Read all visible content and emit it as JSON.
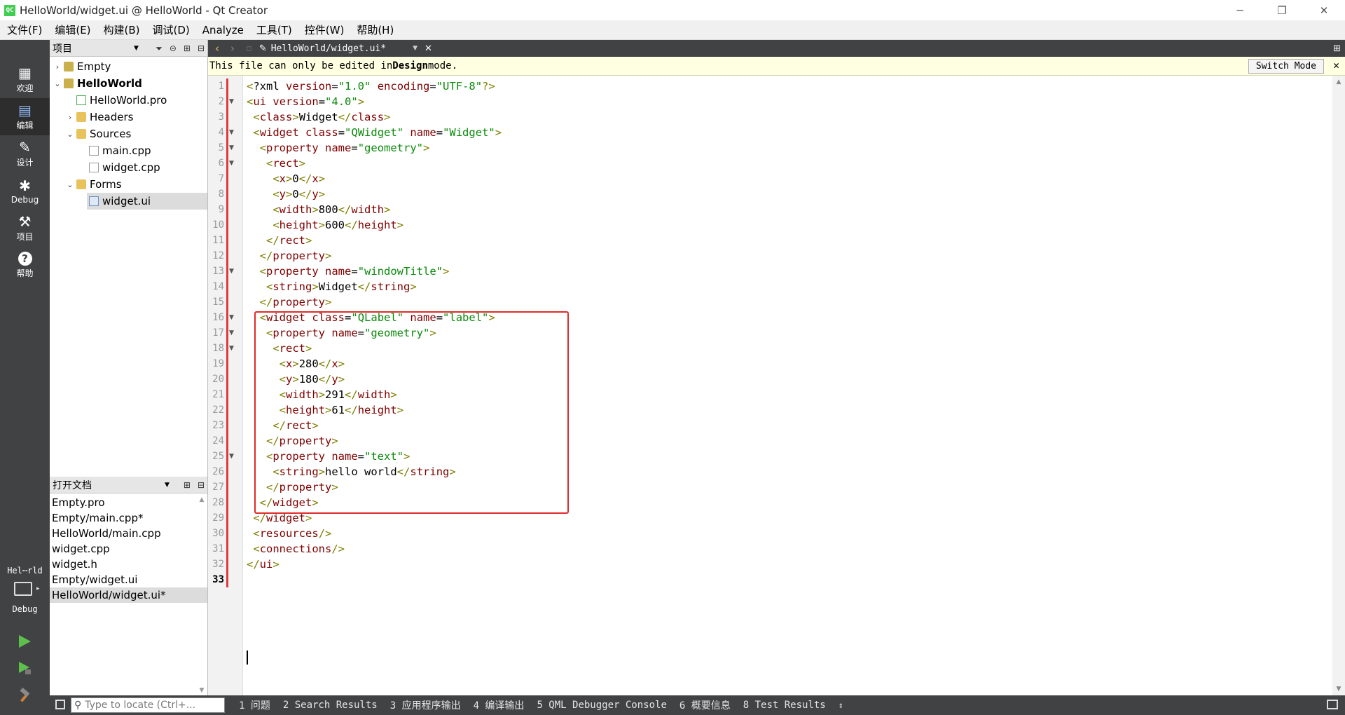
{
  "window": {
    "title": "HelloWorld/widget.ui @ HelloWorld - Qt Creator",
    "app_icon_text": "QC",
    "minimize": "─",
    "restore": "❐",
    "close": "✕"
  },
  "menubar": [
    "文件(F)",
    "编辑(E)",
    "构建(B)",
    "调试(D)",
    "Analyze",
    "工具(T)",
    "控件(W)",
    "帮助(H)"
  ],
  "modes": [
    {
      "label": "欢迎",
      "icon": "grid-icon",
      "glyph": "▦"
    },
    {
      "label": "编辑",
      "icon": "edit-icon",
      "glyph": "▤"
    },
    {
      "label": "设计",
      "icon": "pencil-icon",
      "glyph": "✎"
    },
    {
      "label": "Debug",
      "icon": "bug-icon",
      "glyph": "✱"
    },
    {
      "label": "项目",
      "icon": "wrench-icon",
      "glyph": "⚒"
    },
    {
      "label": "帮助",
      "icon": "help-icon",
      "glyph": "?"
    }
  ],
  "kit": {
    "project": "Hel⋯rld",
    "config": "Debug"
  },
  "project_panel": {
    "title": "项目",
    "tree": [
      {
        "label": "Empty",
        "arrow": "›",
        "bold": false
      },
      {
        "label": "HelloWorld",
        "arrow": "⌄",
        "bold": true
      },
      {
        "label": "HelloWorld.pro",
        "arrow": "",
        "bold": false
      },
      {
        "label": "Headers",
        "arrow": "›",
        "bold": false
      },
      {
        "label": "Sources",
        "arrow": "⌄",
        "bold": false
      },
      {
        "label": "main.cpp",
        "arrow": "",
        "bold": false
      },
      {
        "label": "widget.cpp",
        "arrow": "",
        "bold": false
      },
      {
        "label": "Forms",
        "arrow": "⌄",
        "bold": false
      },
      {
        "label": "widget.ui",
        "arrow": "",
        "bold": false
      }
    ]
  },
  "open_docs": {
    "title": "打开文档",
    "items": [
      "Empty.pro",
      "Empty/main.cpp*",
      "HelloWorld/main.cpp",
      "widget.cpp",
      "widget.h",
      "Empty/widget.ui",
      "HelloWorld/widget.ui*"
    ]
  },
  "editor_toolbar": {
    "filename": "HelloWorld/widget.ui*"
  },
  "infobar": {
    "text_pre": "This file can only be edited in ",
    "text_bold": "Design",
    "text_post": " mode.",
    "switch_button": "Switch Mode"
  },
  "code_lines": [
    "<?xml version=\"1.0\" encoding=\"UTF-8\"?>",
    "<ui version=\"4.0\">",
    " <class>Widget</class>",
    " <widget class=\"QWidget\" name=\"Widget\">",
    "  <property name=\"geometry\">",
    "   <rect>",
    "    <x>0</x>",
    "    <y>0</y>",
    "    <width>800</width>",
    "    <height>600</height>",
    "   </rect>",
    "  </property>",
    "  <property name=\"windowTitle\">",
    "   <string>Widget</string>",
    "  </property>",
    "  <widget class=\"QLabel\" name=\"label\">",
    "   <property name=\"geometry\">",
    "    <rect>",
    "     <x>280</x>",
    "     <y>180</y>",
    "     <width>291</width>",
    "     <height>61</height>",
    "    </rect>",
    "   </property>",
    "   <property name=\"text\">",
    "    <string>hello world</string>",
    "   </property>",
    "  </widget>",
    " </widget>",
    " <resources/>",
    " <connections/>",
    "</ui>",
    ""
  ],
  "fold_lines": [
    2,
    4,
    5,
    6,
    13,
    16,
    17,
    18,
    25
  ],
  "current_line": 33,
  "bottombar": {
    "locator_placeholder": "Type to locate (Ctrl+...",
    "tabs": [
      "1 问题",
      "2 Search Results",
      "3 应用程序输出",
      "4 编译输出",
      "5 QML Debugger Console",
      "6 概要信息",
      "8 Test Results"
    ]
  }
}
